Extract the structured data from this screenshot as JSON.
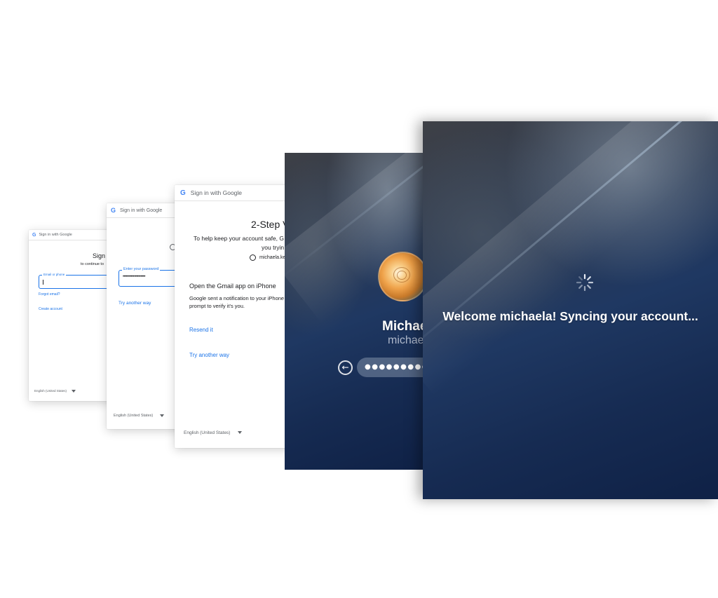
{
  "google_card_1": {
    "header": "Sign in with Google",
    "title": "Sign",
    "subtitle": "to continue to",
    "field_label": "Email or phone",
    "forgot_email": "Forgot email?",
    "create_account": "Create account",
    "language": "English (United States)"
  },
  "google_card_2": {
    "header": "Sign in with Google",
    "field_label": "Enter your password",
    "password_mask": "••••••••••••••••••••",
    "try_another_way": "Try another way",
    "language": "English (United States)"
  },
  "google_card_3": {
    "header": "Sign in with Google",
    "title": "2-Step V",
    "description_line1": "To help keep your account safe, G",
    "description_line2": "you tryin",
    "account": "michaela.ke",
    "section_title": "Open the Gmail app on iPhone",
    "notification_line1": "Google sent a notification to your iPhone",
    "notification_line2": "prompt to verify it's you.",
    "resend": "Resend it",
    "try_another_way": "Try another way",
    "language": "English (United States)"
  },
  "mac_login": {
    "user_name": "Michae",
    "user_id": "michae",
    "password_mask": "●●●●●●●●●●"
  },
  "mac_welcome": {
    "message": "Welcome michaela! Syncing your account..."
  },
  "colors": {
    "google_blue": "#1a73e8",
    "mac_background_dark": "#162b52"
  }
}
